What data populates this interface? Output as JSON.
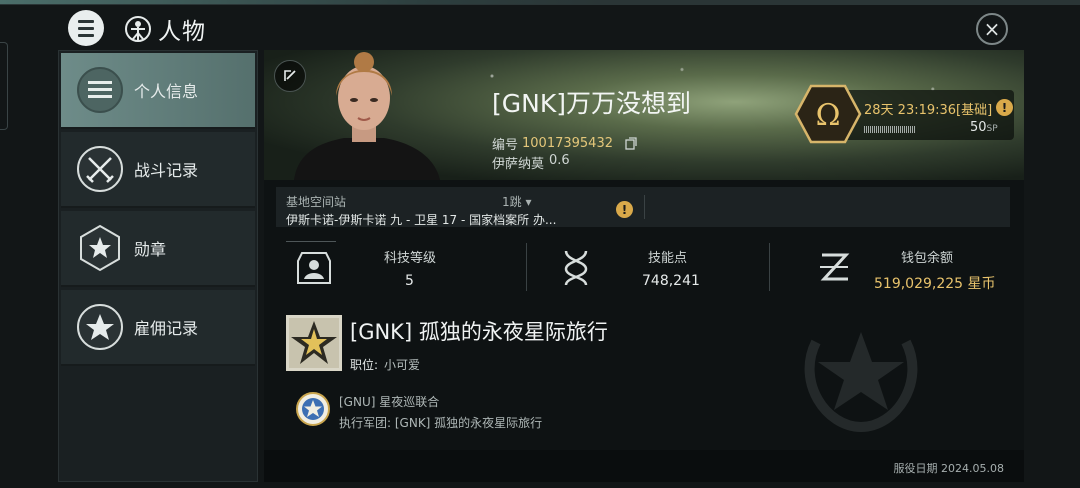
{
  "header": {
    "title": "人物",
    "close_label": "×"
  },
  "sidebar": {
    "items": [
      {
        "label": "个人信息",
        "icon": "list-icon",
        "active": true
      },
      {
        "label": "战斗记录",
        "icon": "crossed-swords-icon",
        "active": false
      },
      {
        "label": "勋章",
        "icon": "star-hexagon-icon",
        "active": false
      },
      {
        "label": "雇佣记录",
        "icon": "star-wreath-icon",
        "active": false
      }
    ]
  },
  "profile": {
    "name": "[GNK]万万没想到",
    "id_label": "编号",
    "id_value": "10017395432",
    "location": "伊萨纳莫",
    "security": "0.6",
    "omega_time": "28天 23:19:36[基础]",
    "sp_value": "50",
    "sp_unit": "SP"
  },
  "station": {
    "label": "基地空间站",
    "jumps": "1跳",
    "name": "伊斯卡诺-伊斯卡诺 九 - 卫星 17 - 国家档案所 办..."
  },
  "stats": [
    {
      "label": "科技等级",
      "value": "5",
      "icon": "tech-level-icon"
    },
    {
      "label": "技能点",
      "value": "748,241",
      "icon": "dna-icon"
    },
    {
      "label": "钱包余额",
      "value": "519,029,225 星币",
      "icon": "isk-icon"
    }
  ],
  "corp": {
    "name": "[GNK] 孤独的永夜星际旅行",
    "position_label": "职位:",
    "position_value": "小可爱",
    "alliance_name": "[GNU] 星夜巡联合",
    "exec_corp": "执行军团: [GNK] 孤独的永夜星际旅行"
  },
  "footer": {
    "service_date": "服役日期 2024.05.08"
  },
  "colors": {
    "accent_gold": "#e8c36c",
    "active_tab": "#6e8c89"
  }
}
